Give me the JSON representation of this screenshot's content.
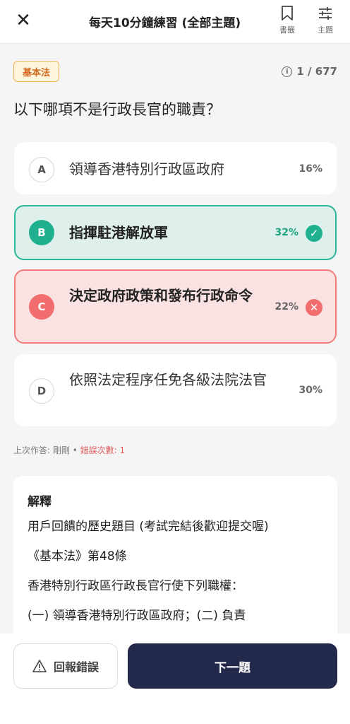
{
  "header": {
    "title": "每天10分鐘練習 (全部主題)",
    "bookmark_label": "書籤",
    "topic_label": "主題"
  },
  "question": {
    "tag": "基本法",
    "counter": "1 / 677",
    "text": "以下哪項不是行政長官的職責？"
  },
  "options": [
    {
      "letter": "A",
      "text": "領導香港特別行政區政府",
      "pct": "16%",
      "state": "neutral"
    },
    {
      "letter": "B",
      "text": "指揮駐港解放軍",
      "pct": "32%",
      "state": "correct"
    },
    {
      "letter": "C",
      "text": "決定政府政策和發布行政命令",
      "pct": "22%",
      "state": "wrong"
    },
    {
      "letter": "D",
      "text": "依照法定程序任免各級法院法官",
      "pct": "30%",
      "state": "neutral"
    }
  ],
  "history": {
    "last": "上次作答: 剛剛",
    "separator": "•",
    "errors": "錯誤次數: 1"
  },
  "explanation": {
    "heading": "解釋",
    "lines": [
      "用戶回饋的歷史題目 (考試完結後歡迎提交喔)",
      "《基本法》第48條",
      "香港特別行政區行政長官行使下列職權：",
      "(一) 領導香港特別行政區政府；(二) 負責"
    ]
  },
  "footer": {
    "report_label": "回報錯誤",
    "next_label": "下一題"
  },
  "colors": {
    "correct": "#20b08f",
    "wrong": "#f26e6e",
    "primary": "#23294a",
    "tag": "#d2691e"
  }
}
